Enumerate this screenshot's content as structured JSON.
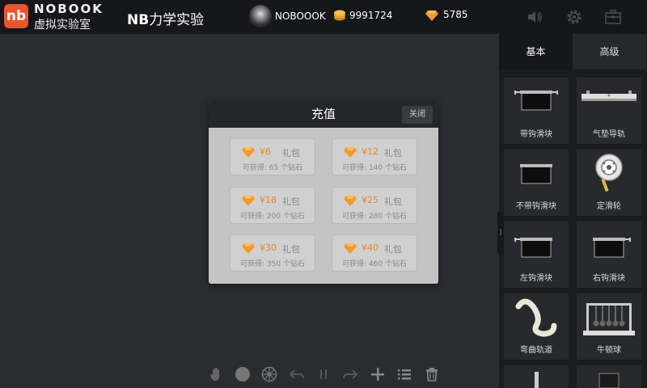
{
  "header": {
    "logo_en": "NOBOOK",
    "logo_cn": "虚拟实验室",
    "logo_mark": "nb",
    "title_bold": "NB",
    "title_rest": "力学实验",
    "username": "NOBOOOK",
    "coins": "9991724",
    "gems": "5785",
    "icons": [
      "sound-icon",
      "gear-icon",
      "toolbox-icon"
    ]
  },
  "sidebar": {
    "tabs": [
      {
        "label": "基本",
        "active": true
      },
      {
        "label": "高级",
        "active": false
      }
    ],
    "items": [
      {
        "label": "带钩滑块",
        "icon": "hooked-slider-icon"
      },
      {
        "label": "气垫导轨",
        "icon": "air-track-icon"
      },
      {
        "label": "不带钩滑块",
        "icon": "plain-slider-icon"
      },
      {
        "label": "定滑轮",
        "icon": "pulley-icon"
      },
      {
        "label": "左钩滑块",
        "icon": "left-hook-slider-icon"
      },
      {
        "label": "右钩滑块",
        "icon": "right-hook-slider-icon"
      },
      {
        "label": "弯曲轨道",
        "icon": "curved-track-icon"
      },
      {
        "label": "牛顿球",
        "icon": "newtons-cradle-icon"
      }
    ]
  },
  "modal": {
    "title": "充值",
    "close_label": "关闭",
    "packages": [
      {
        "price": "¥6",
        "label": "礼包",
        "sub": "可获得: 65 个钻石"
      },
      {
        "price": "¥12",
        "label": "礼包",
        "sub": "可获得: 140 个钻石"
      },
      {
        "price": "¥18",
        "label": "礼包",
        "sub": "可获得: 200 个钻石"
      },
      {
        "price": "¥25",
        "label": "礼包",
        "sub": "可获得: 280 个钻石"
      },
      {
        "price": "¥30",
        "label": "礼包",
        "sub": "可获得: 350 个钻石"
      },
      {
        "price": "¥40",
        "label": "礼包",
        "sub": "可获得: 460 个钻石"
      }
    ]
  },
  "toolbar": {
    "tools": [
      "hand-icon",
      "record-icon",
      "settings-wheel-icon",
      "undo-icon",
      "pause-icon",
      "redo-icon",
      "add-icon",
      "list-icon",
      "trash-icon"
    ]
  },
  "colors": {
    "accent_orange": "#e9552d",
    "price_orange": "#e08a2c",
    "background": "#2a2c30",
    "topbar": "#16171a"
  }
}
